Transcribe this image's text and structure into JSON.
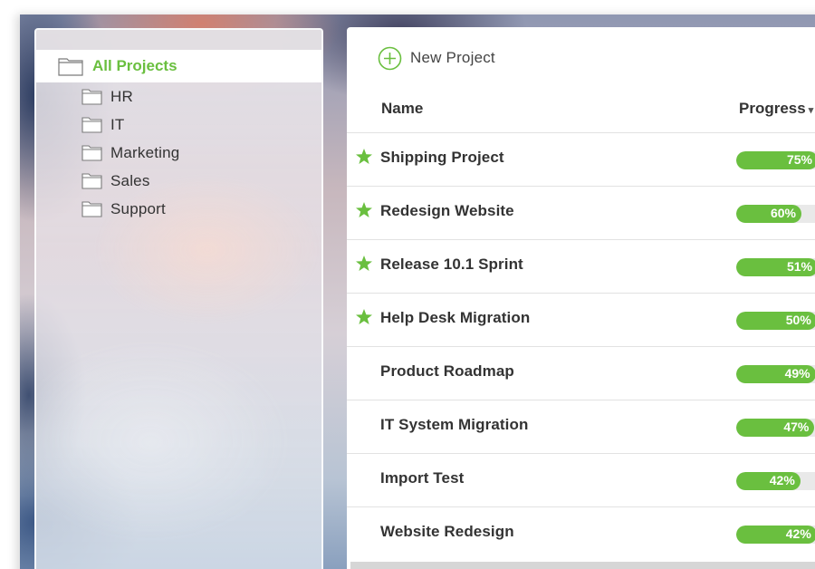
{
  "sidebar": {
    "root": {
      "label": "All Projects",
      "icon": "folder-icon"
    },
    "items": [
      {
        "label": "HR",
        "icon": "folder-icon"
      },
      {
        "label": "IT",
        "icon": "folder-icon"
      },
      {
        "label": "Marketing",
        "icon": "folder-icon"
      },
      {
        "label": "Sales",
        "icon": "folder-icon"
      },
      {
        "label": "Support",
        "icon": "folder-icon"
      }
    ]
  },
  "toolbar": {
    "new_project_label": "New Project",
    "new_project_icon": "plus-circle-icon"
  },
  "table": {
    "columns": {
      "name": "Name",
      "progress": "Progress"
    },
    "rows": [
      {
        "name": "Shipping Project",
        "starred": true,
        "progress": 75,
        "progress_label": "75%"
      },
      {
        "name": "Redesign Website",
        "starred": true,
        "progress": 60,
        "progress_label": "60%"
      },
      {
        "name": "Release 10.1 Sprint",
        "starred": true,
        "progress": 51,
        "progress_label": "51%"
      },
      {
        "name": "Help Desk Migration",
        "starred": true,
        "progress": 50,
        "progress_label": "50%"
      },
      {
        "name": "Product Roadmap",
        "starred": false,
        "progress": 49,
        "progress_label": "49%"
      },
      {
        "name": "IT System Migration",
        "starred": false,
        "progress": 47,
        "progress_label": "47%"
      },
      {
        "name": "Import Test",
        "starred": false,
        "progress": 42,
        "progress_label": "42%"
      },
      {
        "name": "Website Redesign",
        "starred": false,
        "progress": 42,
        "progress_label": "42%"
      }
    ]
  },
  "colors": {
    "accent": "#6abf3f",
    "text": "#333333",
    "track": "#e9e9e9"
  }
}
